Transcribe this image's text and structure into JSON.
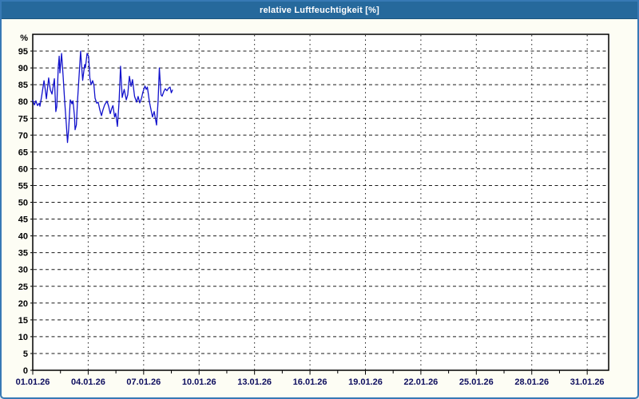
{
  "window": {
    "title": "relative Luftfeuchtigkeit [%]"
  },
  "colors": {
    "frame_border": "#3779b5",
    "titlebar_bg": "#26699c",
    "titlebar_text": "#ffffff",
    "page_bg": "#fdfdf4",
    "plot_bg": "#ffffff",
    "plot_border": "#000000",
    "gridline": "#1a1a1a",
    "y_label": "#000000",
    "x_label": "#0e0e5e",
    "series_line": "#1212cc"
  },
  "chart_data": {
    "type": "line",
    "title": "relative Luftfeuchtigkeit [%]",
    "xlabel": "",
    "ylabel": "%",
    "ylim": [
      0,
      100
    ],
    "y_ticks": [
      0,
      5,
      10,
      15,
      20,
      25,
      30,
      35,
      40,
      45,
      50,
      55,
      60,
      65,
      70,
      75,
      80,
      85,
      90,
      95
    ],
    "xlim_days": [
      1,
      32.16
    ],
    "x_tick_days": [
      1,
      4,
      7,
      10,
      13,
      16,
      19,
      22,
      25,
      28,
      31
    ],
    "x_tick_labels": [
      "01.01.26",
      "04.01.26",
      "07.01.26",
      "10.01.26",
      "13.01.26",
      "16.01.26",
      "19.01.26",
      "22.01.26",
      "25.01.26",
      "28.01.26",
      "31.01.26"
    ],
    "x_minor_tick_days": [
      2.5,
      5.5,
      8.5,
      11.5,
      14.5,
      17.5,
      20.5,
      23.5,
      26.5,
      29.5
    ],
    "grid": "dashed",
    "legend": "none",
    "series": [
      {
        "name": "relative Luftfeuchtigkeit",
        "color": "#1212cc",
        "points": [
          [
            1.0,
            80.3
          ],
          [
            1.09,
            79.0
          ],
          [
            1.17,
            80.2
          ],
          [
            1.26,
            78.8
          ],
          [
            1.35,
            79.5
          ],
          [
            1.39,
            78.6
          ],
          [
            1.48,
            81.5
          ],
          [
            1.61,
            86.2
          ],
          [
            1.69,
            83.0
          ],
          [
            1.74,
            80.8
          ],
          [
            1.86,
            87.0
          ],
          [
            1.95,
            83.5
          ],
          [
            2.04,
            82.2
          ],
          [
            2.17,
            86.8
          ],
          [
            2.25,
            77.0
          ],
          [
            2.3,
            78.5
          ],
          [
            2.38,
            90.0
          ],
          [
            2.43,
            93.5
          ],
          [
            2.47,
            88.5
          ],
          [
            2.56,
            94.3
          ],
          [
            2.64,
            88.0
          ],
          [
            2.73,
            80.0
          ],
          [
            2.82,
            73.0
          ],
          [
            2.88,
            67.8
          ],
          [
            2.94,
            71.5
          ],
          [
            3.03,
            80.5
          ],
          [
            3.12,
            79.3
          ],
          [
            3.18,
            80.2
          ],
          [
            3.25,
            76.0
          ],
          [
            3.29,
            71.6
          ],
          [
            3.36,
            73.0
          ],
          [
            3.42,
            80.0
          ],
          [
            3.51,
            88.0
          ],
          [
            3.59,
            95.0
          ],
          [
            3.7,
            86.3
          ],
          [
            3.81,
            91.0
          ],
          [
            3.85,
            90.0
          ],
          [
            3.94,
            94.3
          ],
          [
            4.02,
            93.5
          ],
          [
            4.09,
            87.0
          ],
          [
            4.16,
            85.0
          ],
          [
            4.24,
            86.2
          ],
          [
            4.31,
            84.8
          ],
          [
            4.37,
            81.0
          ],
          [
            4.46,
            79.5
          ],
          [
            4.54,
            79.8
          ],
          [
            4.63,
            77.5
          ],
          [
            4.72,
            75.8
          ],
          [
            4.8,
            77.5
          ],
          [
            4.89,
            79.0
          ],
          [
            5.02,
            80.1
          ],
          [
            5.11,
            78.5
          ],
          [
            5.19,
            76.4
          ],
          [
            5.28,
            78.0
          ],
          [
            5.34,
            78.8
          ],
          [
            5.43,
            75.4
          ],
          [
            5.49,
            76.5
          ],
          [
            5.58,
            72.6
          ],
          [
            5.67,
            80.0
          ],
          [
            5.75,
            90.5
          ],
          [
            5.84,
            81.2
          ],
          [
            5.95,
            83.6
          ],
          [
            6.06,
            80.5
          ],
          [
            6.14,
            82.0
          ],
          [
            6.23,
            87.5
          ],
          [
            6.32,
            84.5
          ],
          [
            6.4,
            86.5
          ],
          [
            6.51,
            81.5
          ],
          [
            6.62,
            79.8
          ],
          [
            6.7,
            81.5
          ],
          [
            6.79,
            79.6
          ],
          [
            6.88,
            80.9
          ],
          [
            6.96,
            82.8
          ],
          [
            7.07,
            84.6
          ],
          [
            7.14,
            83.6
          ],
          [
            7.2,
            84.3
          ],
          [
            7.31,
            80.0
          ],
          [
            7.4,
            77.5
          ],
          [
            7.48,
            75.4
          ],
          [
            7.57,
            77.0
          ],
          [
            7.7,
            73.0
          ],
          [
            7.78,
            80.0
          ],
          [
            7.85,
            90.0
          ],
          [
            7.94,
            82.0
          ],
          [
            8.0,
            81.6
          ],
          [
            8.09,
            83.0
          ],
          [
            8.17,
            83.8
          ],
          [
            8.26,
            83.2
          ],
          [
            8.35,
            84.0
          ],
          [
            8.43,
            84.3
          ],
          [
            8.5,
            82.6
          ],
          [
            8.56,
            83.4
          ]
        ]
      }
    ]
  }
}
